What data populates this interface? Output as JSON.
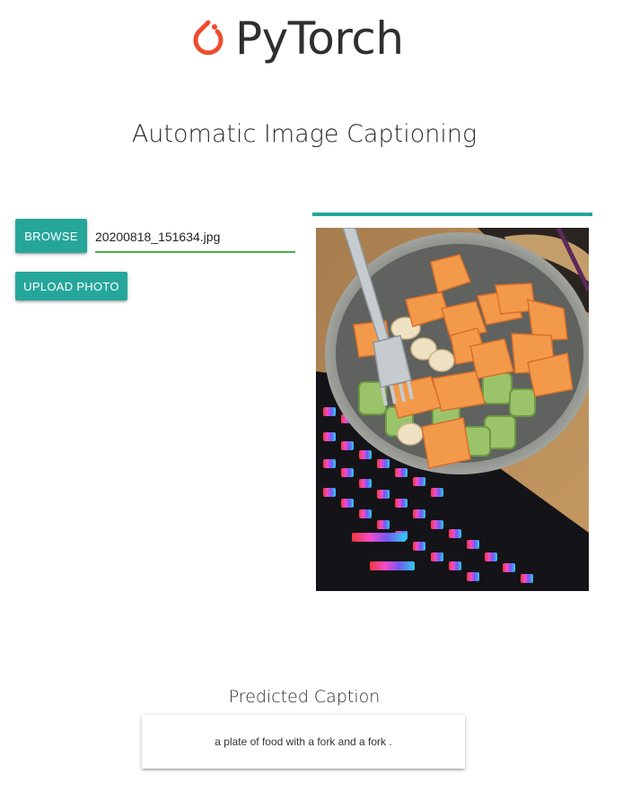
{
  "logo": {
    "text": "PyTorch",
    "icon": "pytorch-flame-icon",
    "icon_color": "#ee4c2c"
  },
  "page": {
    "title": "Automatic Image Captioning"
  },
  "upload_form": {
    "browse_label": "BROWSE",
    "file_name": "20200818_151634.jpg",
    "upload_label": "UPLOAD PHOTO",
    "accent_color": "#26a69a",
    "field_underline_color": "#4caf50"
  },
  "upload_progress": {
    "percent": 100
  },
  "preview": {
    "image": "uploaded-photo"
  },
  "result": {
    "heading": "Predicted Caption",
    "caption": "a plate of food with a fork and a fork ."
  }
}
